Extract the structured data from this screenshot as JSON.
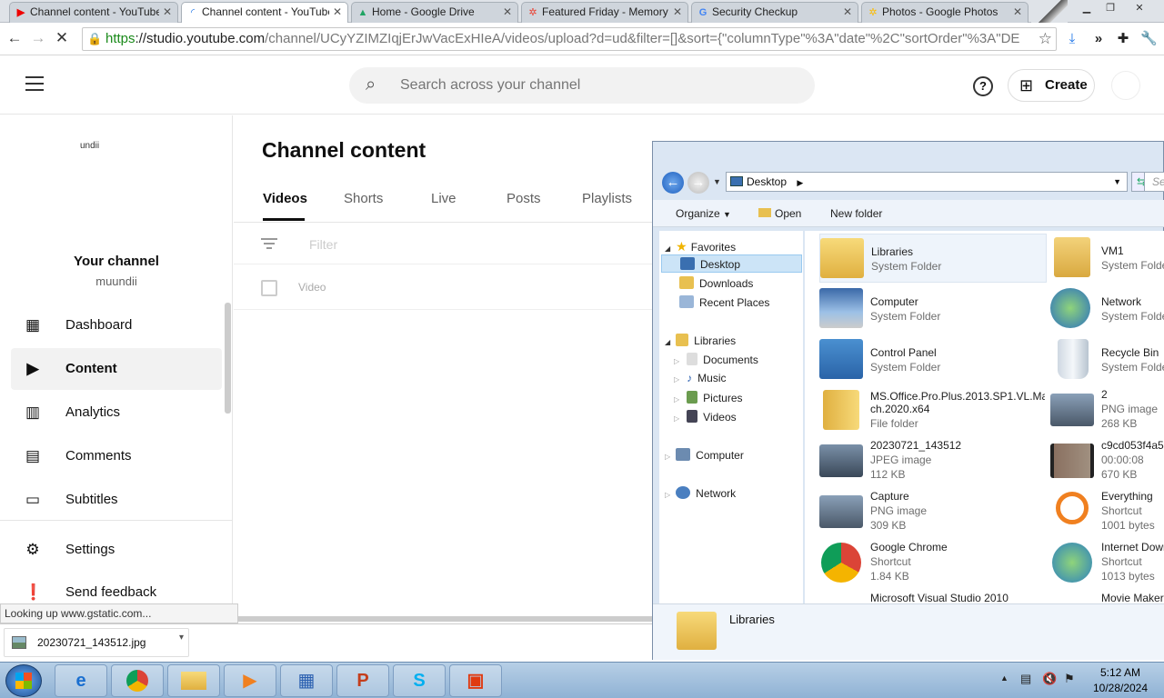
{
  "browser": {
    "tabs": [
      {
        "title": "Channel content - YouTube",
        "icon": "youtube-icon"
      },
      {
        "title": "Channel content - YouTube",
        "icon": "loading-spinner-icon"
      },
      {
        "title": "Home - Google Drive",
        "icon": "google-drive-icon"
      },
      {
        "title": "Featured Friday - Memory",
        "icon": "google-photos-icon"
      },
      {
        "title": "Security Checkup",
        "icon": "google-icon"
      },
      {
        "title": "Photos - Google Photos",
        "icon": "google-photos-icon"
      }
    ],
    "url_scheme": "https",
    "url_host": "://studio.youtube.com",
    "url_path": "/channel/UCyYZIMZIqjErJwVacExHIeA/videos/upload?d=ud&filter=[]&sort={\"columnType\"%3A\"date\"%2C\"sortOrder\"%3A\"DE"
  },
  "studio": {
    "search_placeholder": "Search across your channel",
    "create_label": "Create",
    "channel_logo_text": "undii",
    "channel_title": "Your channel",
    "channel_name": "muundii",
    "nav": [
      {
        "label": "Dashboard",
        "icon": "dashboard-icon"
      },
      {
        "label": "Content",
        "icon": "content-icon"
      },
      {
        "label": "Analytics",
        "icon": "analytics-icon"
      },
      {
        "label": "Comments",
        "icon": "comments-icon"
      },
      {
        "label": "Subtitles",
        "icon": "subtitles-icon"
      },
      {
        "label": "Settings",
        "icon": "gear-icon"
      },
      {
        "label": "Send feedback",
        "icon": "feedback-icon"
      }
    ],
    "page_title": "Channel content",
    "tabs": [
      "Videos",
      "Shorts",
      "Live",
      "Posts",
      "Playlists"
    ],
    "filter_placeholder": "Filter",
    "video_column": "Video"
  },
  "status_text": "Looking up www.gstatic.com...",
  "download": {
    "filename": "20230721_143512.jpg"
  },
  "explorer": {
    "path_segment": "Desktop",
    "search_placeholder": "Se",
    "toolbar": {
      "organize": "Organize",
      "open": "Open",
      "new_folder": "New folder"
    },
    "nav_tree": {
      "favorites": "Favorites",
      "fav_items": [
        "Desktop",
        "Downloads",
        "Recent Places"
      ],
      "libraries": "Libraries",
      "lib_items": [
        "Documents",
        "Music",
        "Pictures",
        "Videos"
      ],
      "computer": "Computer",
      "network": "Network"
    },
    "items": [
      {
        "name": "Libraries",
        "line1": "System Folder",
        "line2": ""
      },
      {
        "name": "VM1",
        "line1": "System Folde",
        "line2": ""
      },
      {
        "name": "Computer",
        "line1": "System Folder",
        "line2": ""
      },
      {
        "name": "Network",
        "line1": "System Folde",
        "line2": ""
      },
      {
        "name": "Control Panel",
        "line1": "System Folder",
        "line2": ""
      },
      {
        "name": "Recycle Bin",
        "line1": "System Folde",
        "line2": ""
      },
      {
        "name": "MS.Office.Pro.Plus.2013.SP1.VL.Mar",
        "name2": "ch.2020.x64",
        "line1": "File folder",
        "line2": ""
      },
      {
        "name": "2",
        "line1": "PNG image",
        "line2": "268 KB"
      },
      {
        "name": "20230721_143512",
        "line1": "JPEG image",
        "line2": "112 KB"
      },
      {
        "name": "c9cd053f4a5e",
        "line1": "00:00:08",
        "line2": "670 KB"
      },
      {
        "name": "Capture",
        "line1": "PNG image",
        "line2": "309 KB"
      },
      {
        "name": "Everything",
        "line1": "Shortcut",
        "line2": "1001 bytes"
      },
      {
        "name": "Google Chrome",
        "line1": "Shortcut",
        "line2": "1.84 KB"
      },
      {
        "name": "Internet Dowr",
        "line1": "Shortcut",
        "line2": "1013 bytes"
      },
      {
        "name": "Microsoft Visual Studio 2010",
        "line1": "",
        "line2": ""
      },
      {
        "name": "Movie Maker",
        "line1": "",
        "line2": ""
      }
    ],
    "details_name": "Libraries"
  },
  "taskbar": {
    "time": "5:12 AM",
    "date": "10/28/2024"
  }
}
